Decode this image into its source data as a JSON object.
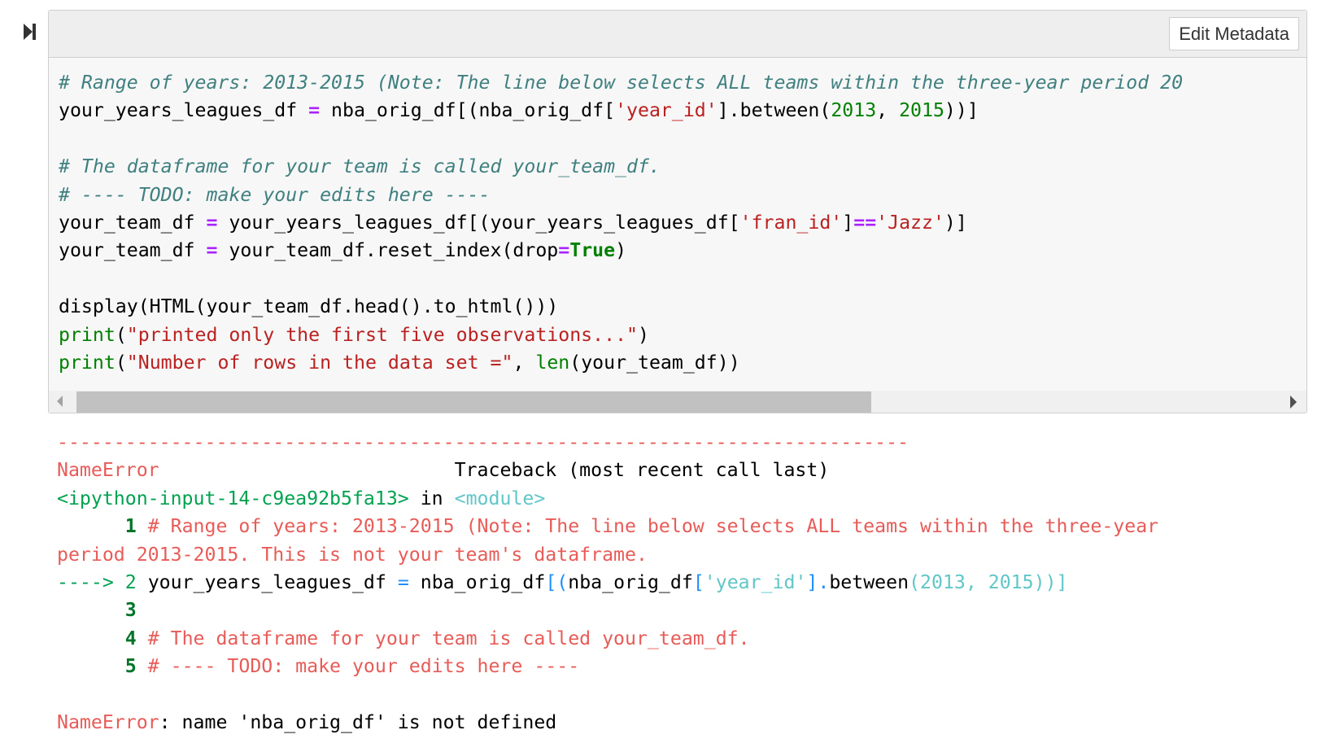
{
  "cell": {
    "run_indicator_icon": "step-forward-icon",
    "toolbar": {
      "edit_metadata_label": "Edit Metadata"
    },
    "code": {
      "line1_comment": "# Range of years: 2013-2015 (Note: The line below selects ALL teams within the three-year period 20",
      "line2": {
        "lhs": "your_years_leagues_df ",
        "op": "=",
        "mid1": " nba_orig_df[(nba_orig_df[",
        "str": "'year_id'",
        "mid2": "].between(",
        "num1": "2013",
        "sep": ", ",
        "num2": "2015",
        "end": "))]"
      },
      "line4_comment": "# The dataframe for your team is called your_team_df.",
      "line5_comment": "# ---- TODO: make your edits here ----",
      "line6": {
        "lhs": "your_team_df ",
        "op": "=",
        "mid1": " your_years_leagues_df[(your_years_leagues_df[",
        "str1": "'fran_id'",
        "mid2": "]",
        "op2": "==",
        "str2": "'Jazz'",
        "end": ")]"
      },
      "line7": {
        "lhs": "your_team_df ",
        "op": "=",
        "mid": " your_team_df.reset_index(drop",
        "op2": "=",
        "kw": "True",
        "end": ")"
      },
      "line9": "display(HTML(your_team_df.head().to_html()))",
      "line10": {
        "fn": "print",
        "open": "(",
        "str": "\"printed only the first five observations...\"",
        "close": ")"
      },
      "line11": {
        "fn": "print",
        "open": "(",
        "str": "\"Number of rows in the data set =\"",
        "sep": ", ",
        "fn2": "len",
        "rest": "(your_team_df))"
      }
    },
    "scrollbar": {
      "left_icon": "scroll-left-arrow-icon",
      "right_icon": "scroll-right-arrow-icon"
    }
  },
  "output": {
    "separator": "---------------------------------------------------------------------------",
    "error_name": "NameError",
    "traceback_header": "                          Traceback (most recent call last)",
    "input_ref": "<ipython-input-14-c9ea92b5fa13>",
    "in_text": " in ",
    "module_ref": "<module>",
    "tb_lines": [
      {
        "prefix": "      ",
        "num": "1",
        "text": " # Range of years: 2013-2015 (Note: The line below selects ALL teams within the three-year"
      },
      {
        "prefix": "",
        "num": "",
        "text": "period 2013-2015. This is not your team's dataframe."
      },
      {
        "prefix": "----> ",
        "num": "2",
        "text": ""
      },
      {
        "prefix": "      ",
        "num": "3",
        "text": ""
      },
      {
        "prefix": "      ",
        "num": "4",
        "text": " # The dataframe for your team is called your_team_df."
      },
      {
        "prefix": "      ",
        "num": "5",
        "text": " # ---- TODO: make your edits here ----"
      }
    ],
    "line2_parts": {
      "a": " your_years_leagues_df ",
      "op": "=",
      "b": " nba_orig_df",
      "br1": "[(",
      "c": "nba_orig_df",
      "br2": "[",
      "str": "'year_id'",
      "br3": "].",
      "d": "between",
      "e": "(2013, 2015))]"
    },
    "final_error_name": "NameError",
    "final_error_msg": ": name 'nba_orig_df' is not defined"
  }
}
